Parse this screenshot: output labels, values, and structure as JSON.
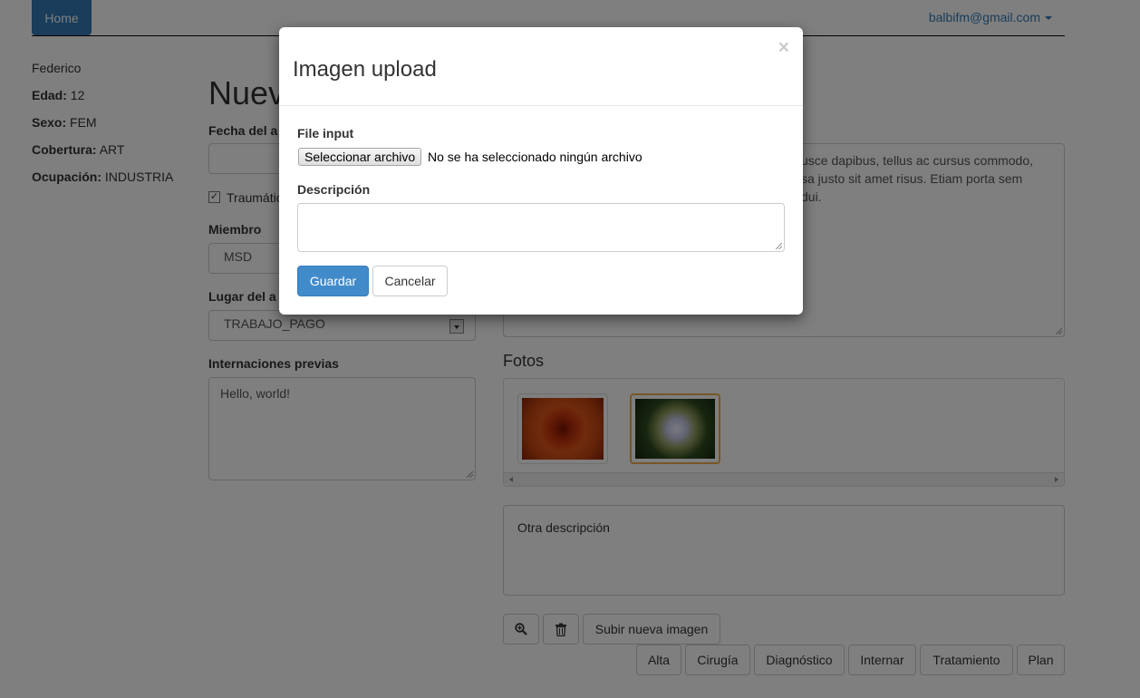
{
  "navbar": {
    "home_label": "Home",
    "user_email": "balbifm@gmail.com"
  },
  "patient": {
    "name": "Federico",
    "age_label": "Edad:",
    "age": "12",
    "sex_label": "Sexo:",
    "sex": "FEM",
    "coverage_label": "Cobertura:",
    "coverage": "ART",
    "occupation_label": "Ocupación:",
    "occupation": "INDUSTRIA"
  },
  "page": {
    "title": "Nuevo"
  },
  "form": {
    "fecha_label": "Fecha del a",
    "traumatic_label": "Traumátic",
    "traumatic_checked": true,
    "miembro_label": "Miembro",
    "miembro_value": "MSD",
    "lugar_label": "Lugar del a",
    "lugar_value": "TRABAJO_PAGO",
    "internaciones_label": "Internaciones previas",
    "internaciones_value": "Hello, world!"
  },
  "description_text": {
    "line1": "usce dapibus, tellus ac cursus commodo,",
    "line2": "sa justo sit amet risus. Etiam porta sem",
    "line3": "dui."
  },
  "fotos": {
    "title": "Fotos",
    "photos": [
      {
        "name": "orange-flower",
        "selected": false
      },
      {
        "name": "hydrangea",
        "selected": true
      }
    ],
    "description": "Otra descripción"
  },
  "photo_actions": {
    "upload_label": "Subir nueva imagen"
  },
  "bottom_tabs": [
    "Alta",
    "Cirugía",
    "Diagnóstico",
    "Internar",
    "Tratamiento",
    "Plan"
  ],
  "modal": {
    "title": "Imagen upload",
    "close_symbol": "×",
    "file_label": "File input",
    "file_button": "Seleccionar archivo",
    "file_status": "No se ha seleccionado ningún archivo",
    "description_label": "Descripción",
    "save_label": "Guardar",
    "cancel_label": "Cancelar"
  }
}
